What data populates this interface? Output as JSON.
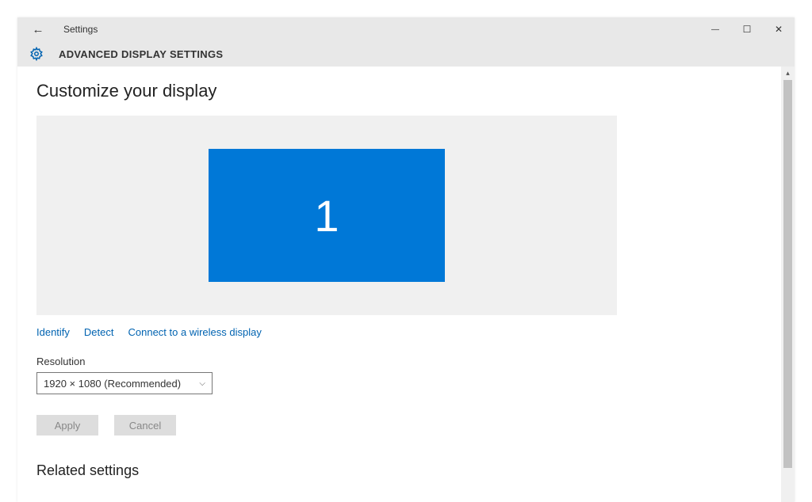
{
  "app": {
    "name": "Settings",
    "page_title": "ADVANCED DISPLAY SETTINGS"
  },
  "main": {
    "heading": "Customize your display",
    "monitor_label": "1",
    "links": {
      "identify": "Identify",
      "detect": "Detect",
      "wireless": "Connect to a wireless display"
    },
    "resolution": {
      "label": "Resolution",
      "value": "1920 × 1080 (Recommended)"
    },
    "buttons": {
      "apply": "Apply",
      "cancel": "Cancel"
    },
    "related_heading": "Related settings"
  }
}
